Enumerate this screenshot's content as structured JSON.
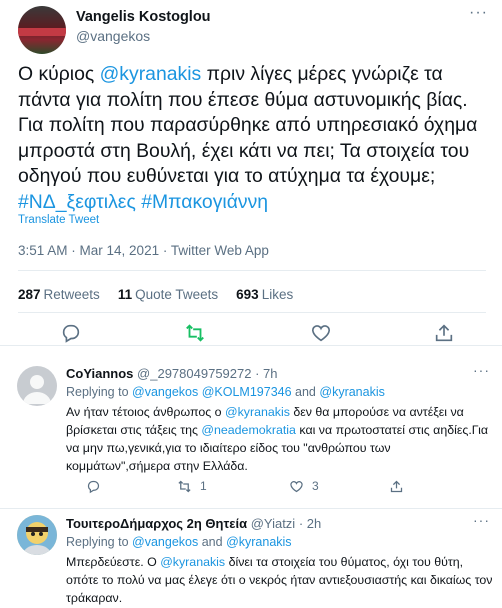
{
  "main_tweet": {
    "author_name": "Vangelis Kostoglou",
    "author_handle": "@vangekos",
    "text_1": "Ο κύριος ",
    "mention_1": "@kyranakis",
    "text_2": " πριν λίγες μέρες γνώριζε τα πάντα για πολίτη που έπεσε θύμα αστυνομικής βίας. Για πολίτη που παρασύρθηκε από υπηρεσιακό όχημα μπροστά στη Βουλή, έχει κάτι να πει; Τα στοιχεία του οδηγού που ευθύνεται για το ατύχημα τα έχουμε; ",
    "hashtag_1": "#ΝΔ_ξεφτιλες",
    "hashtag_2": "#Μπακογιάννη",
    "translate_label": "Translate Tweet",
    "time": "3:51 AM",
    "date": "Mar 14, 2021",
    "source": "Twitter Web App",
    "retweets_count": "287",
    "retweets_label": "Retweets",
    "quotes_count": "11",
    "quotes_label": "Quote Tweets",
    "likes_count": "693",
    "likes_label": "Likes"
  },
  "replies": [
    {
      "name": "CoYiannos",
      "handle": "@_2978049759272",
      "time": "7h",
      "replying_label": "Replying to",
      "replying_to_1": "@vangekos",
      "replying_to_2": "@KOLM197346",
      "replying_and": "and",
      "replying_to_3": "@kyranakis",
      "text_1": "Αν ήταν τέτοιος άνθρωπος ο ",
      "mention_1": "@kyranakis",
      "text_2": " δεν θα μπορούσε να αντέξει να βρίσκεται στις τάξεις της ",
      "mention_2": "@neademokratia",
      "text_3": " και να πρωτοστατεί στις αηδίες.Για να μην πω,γενικά,για το ιδιαίτερο είδος του \"ανθρώπου των κομμάτων\",σήμερα στην Ελλάδα.",
      "retweets": "1",
      "likes": "3"
    },
    {
      "name": "ΤουιτεροΔήμαρχος 2η Θητεία",
      "handle": "@Yiatzi",
      "time": "2h",
      "replying_label": "Replying to",
      "replying_to_1": "@vangekos",
      "replying_and": "and",
      "replying_to_2": "@kyranakis",
      "text_1": "Μπερδεύεστε. Ο ",
      "mention_1": "@kyranakis",
      "text_2": " δίνει τα στοιχεία του θύματος, όχι του θύτη, οπότε το πολύ να μας έλεγε ότι ο νεκρός ήταν αντιεξουσιαστής και δικαίως τον τράκαραν."
    }
  ],
  "colors": {
    "link": "#1b95e0",
    "muted": "#5b7083",
    "retweet_green": "#17bf63",
    "divider": "#e6ecf0"
  },
  "icons": [
    "more-icon",
    "reply-icon",
    "retweet-icon",
    "like-icon",
    "share-icon"
  ]
}
